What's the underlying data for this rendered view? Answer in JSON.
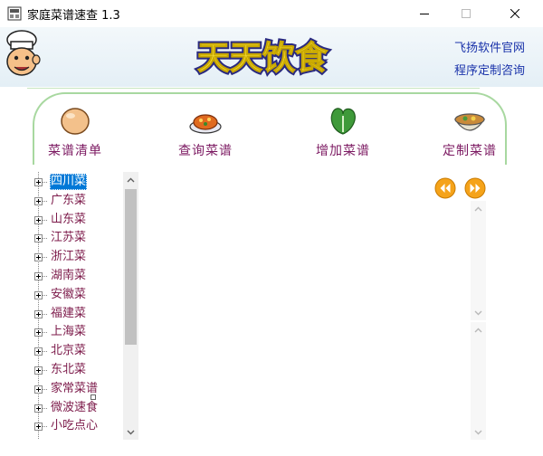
{
  "window": {
    "title": "家庭菜谱速查 1.3",
    "minimize_icon": "minimize-icon",
    "maximize_icon": "maximize-icon",
    "close_icon": "close-icon"
  },
  "banner": {
    "logo_text": "天天饮食",
    "links": [
      "飞扬软件官网",
      "程序定制咨询"
    ]
  },
  "nav": {
    "items": [
      {
        "label": "菜谱清单",
        "icon": "egg-icon"
      },
      {
        "label": "查询菜谱",
        "icon": "dish-icon"
      },
      {
        "label": "增加菜谱",
        "icon": "vegetable-icon"
      },
      {
        "label": "定制菜谱",
        "icon": "bowl-icon"
      }
    ]
  },
  "tree": {
    "items": [
      "四川菜",
      "广东菜",
      "山东菜",
      "江苏菜",
      "浙江菜",
      "湖南菜",
      "安徽菜",
      "福建菜",
      "上海菜",
      "北京菜",
      "东北菜",
      "家常菜谱",
      "微波速食",
      "小吃点心"
    ],
    "selected_index": 0
  },
  "controls": {
    "prev_icon": "rewind-icon",
    "next_icon": "fast-forward-icon"
  },
  "colors": {
    "accent": "#0078d7",
    "nav_text": "#7c1a62",
    "tree_text": "#7c1a4a",
    "link": "#1a33aa",
    "panel_border": "#a8d8a0",
    "button_orange": "#f5a31a"
  }
}
